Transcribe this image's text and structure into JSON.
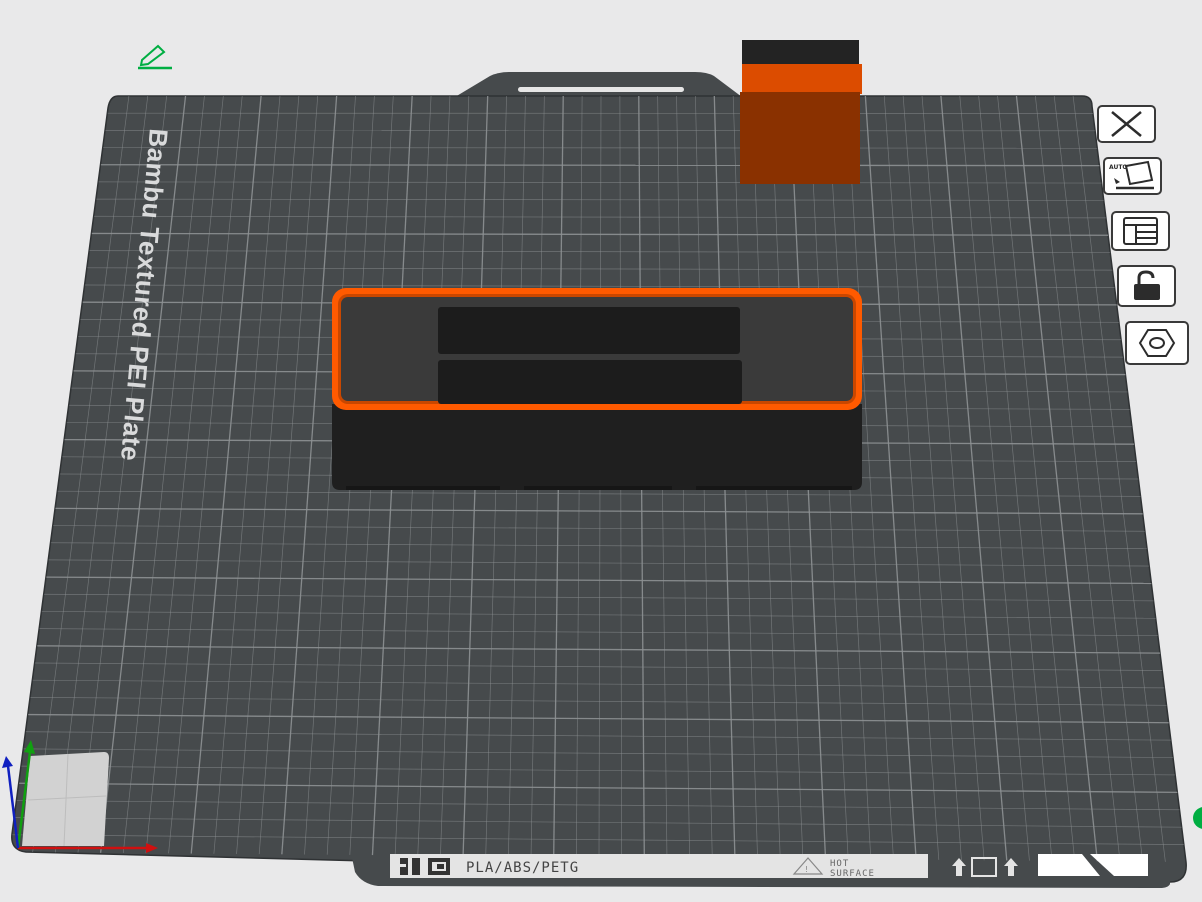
{
  "plate": {
    "name": "Bambu Textured PEI Plate",
    "material_label": "PLA/ABS/PETG",
    "warning_line1": "HOT",
    "warning_line2": "SURFACE"
  },
  "plate_buttons": [
    {
      "name": "remove-plate-button",
      "icon": "close-icon"
    },
    {
      "name": "auto-arrange-plate-button",
      "icon": "auto-orient-icon",
      "badge": "AUTO"
    },
    {
      "name": "arrange-plate-button",
      "icon": "arrange-icon"
    },
    {
      "name": "lock-plate-button",
      "icon": "lock-open-icon"
    },
    {
      "name": "plate-settings-button",
      "icon": "hex-nut-icon"
    }
  ],
  "colors": {
    "background": "#e9e9ea",
    "plate": "#464a4c",
    "grid": "#8e9294",
    "accent": "#ff5a00",
    "model_body": "#1e1e1e",
    "edit_icon": "#00ae42",
    "axis_x": "#d01010",
    "axis_y": "#10a010",
    "axis_z": "#1020c0"
  },
  "icons": {
    "edit": "edit-pencil-icon",
    "axes": "axis-gizmo-icon",
    "scroll_indicator": "status-dot-icon"
  }
}
